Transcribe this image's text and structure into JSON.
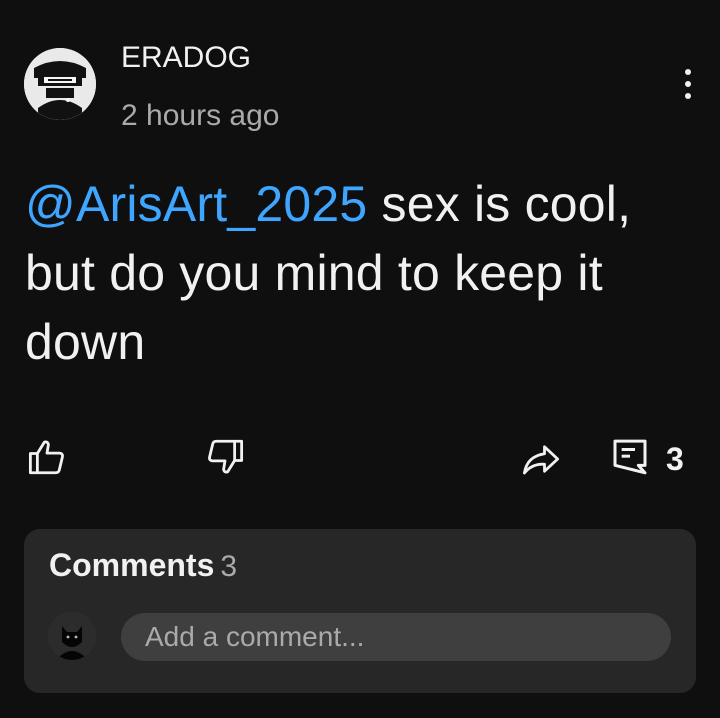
{
  "comment": {
    "author": "ERADOG",
    "timestamp": "2 hours ago",
    "mention": "@ArisArt_2025",
    "text": " sex is cool, but do you mind to keep it down"
  },
  "actions": {
    "like_icon": "thumbs-up-icon",
    "dislike_icon": "thumbs-down-icon",
    "share_icon": "share-icon",
    "reply_icon": "comment-reply-icon",
    "reply_count": "3"
  },
  "comments_panel": {
    "title": "Comments",
    "count": "3",
    "input_placeholder": "Add a comment..."
  },
  "colors": {
    "background": "#0f0f0f",
    "mention": "#3ea6ff",
    "panel": "#272727",
    "input": "#3f3f3f",
    "secondary_text": "#aaaaaa"
  }
}
